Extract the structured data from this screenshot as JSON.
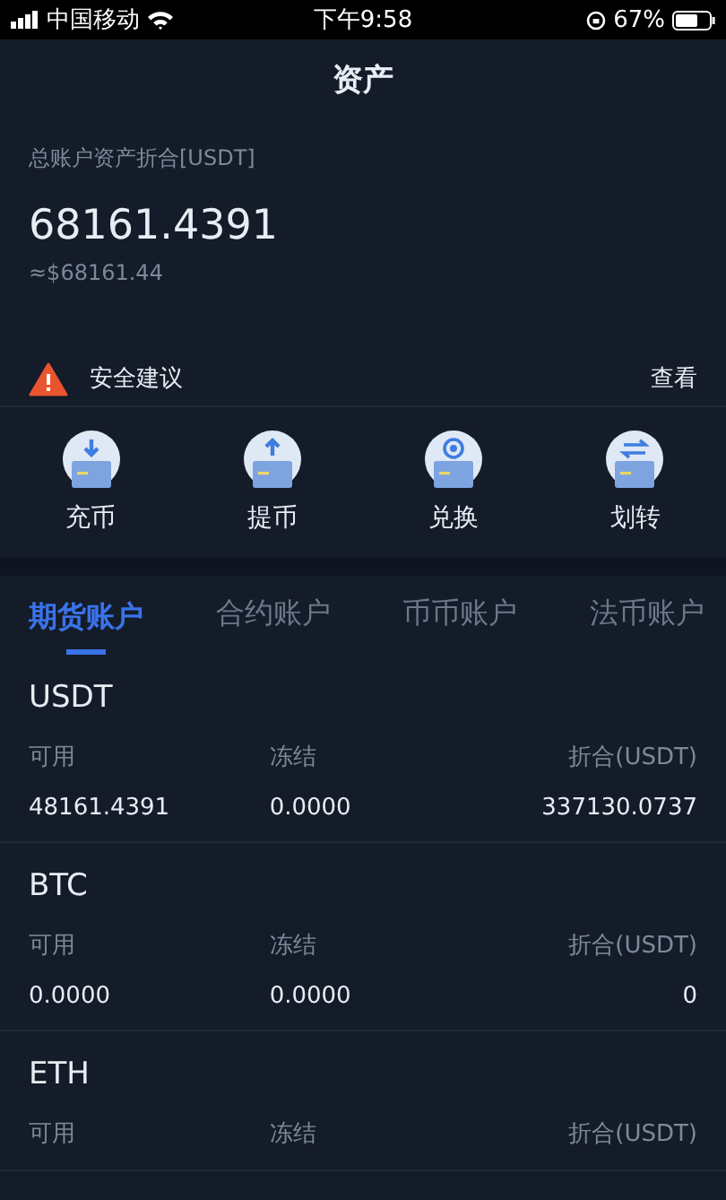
{
  "status_bar": {
    "carrier": "中国移动",
    "time": "下午9:58",
    "battery": "67%"
  },
  "header": {
    "title": "资产"
  },
  "summary": {
    "label": "总账户资产折合[USDT]",
    "total": "68161.4391",
    "fiat": "≈$68161.44"
  },
  "notice": {
    "text": "安全建议",
    "action": "查看"
  },
  "actions": [
    {
      "kind": "deposit",
      "label": "充币"
    },
    {
      "kind": "withdraw",
      "label": "提币"
    },
    {
      "kind": "exchange",
      "label": "兑换"
    },
    {
      "kind": "transfer",
      "label": "划转"
    }
  ],
  "tabs": [
    {
      "label": "期货账户",
      "selected": true
    },
    {
      "label": "合约账户",
      "selected": false
    },
    {
      "label": "币币账户",
      "selected": false
    },
    {
      "label": "法币账户",
      "selected": false
    }
  ],
  "coins": [
    {
      "name": "USDT",
      "columns": [
        "可用",
        "冻结",
        "折合(USDT)"
      ],
      "values": [
        "48161.4391",
        "0.0000",
        "337130.0737"
      ]
    },
    {
      "name": "BTC",
      "columns": [
        "可用",
        "冻结",
        "折合(USDT)"
      ],
      "values": [
        "0.0000",
        "0.0000",
        "0"
      ]
    },
    {
      "name": "ETH",
      "columns": [
        "可用",
        "冻结",
        "折合(USDT)"
      ]
    }
  ]
}
